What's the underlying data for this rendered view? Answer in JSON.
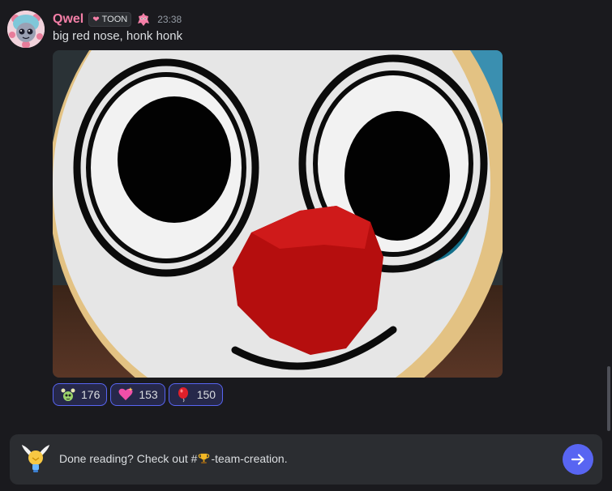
{
  "message": {
    "author": "Qwel",
    "tag": {
      "icon": "heart-icon",
      "label": "TOON"
    },
    "role_icon": "pink-creature-icon",
    "timestamp": "23:38",
    "text": "big red nose, honk honk",
    "attachment": {
      "type": "image",
      "subject": "clown-face-render"
    },
    "reactions": [
      {
        "emoji": "alien-creature-emoji",
        "count": "176"
      },
      {
        "emoji": "sparkling-heart-emoji",
        "count": "153"
      },
      {
        "emoji": "red-balloon-emoji",
        "count": "150"
      }
    ]
  },
  "notice": {
    "icon": "winged-lightbulb-icon",
    "text_before": "Done reading? Check out #",
    "text_after": "-team-creation.",
    "channel_icon": "trophy-icon",
    "button_icon": "arrow-right-icon"
  },
  "colors": {
    "background": "#1a1a1e",
    "username": "#f47fa7",
    "accent": "#5865f2",
    "reaction_bg": "#26284a",
    "notice_bg": "#2b2d31"
  }
}
